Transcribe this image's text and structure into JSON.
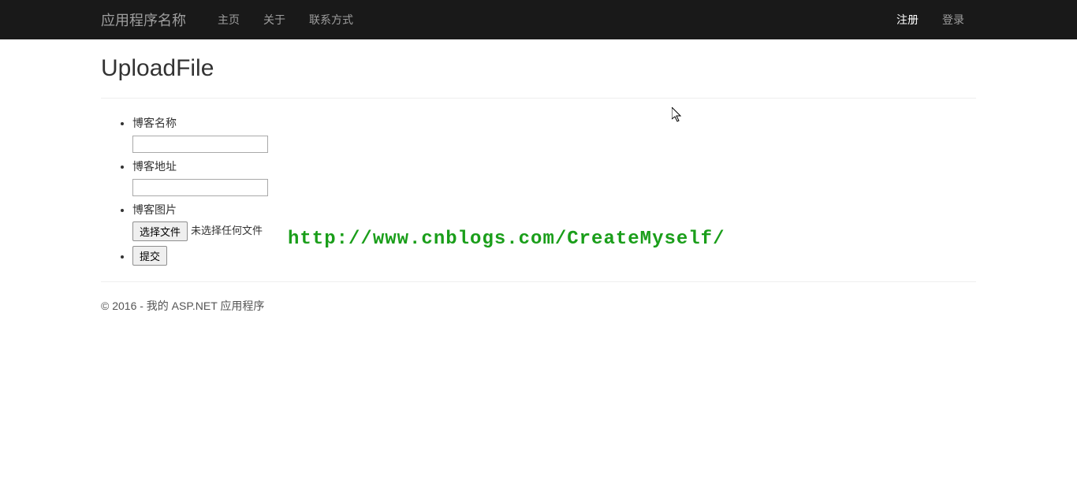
{
  "navbar": {
    "brand": "应用程序名称",
    "links": {
      "home": "主页",
      "about": "关于",
      "contact": "联系方式"
    },
    "right": {
      "register": "注册",
      "login": "登录"
    }
  },
  "page": {
    "title": "UploadFile"
  },
  "form": {
    "blog_name_label": "博客名称",
    "blog_name_value": "",
    "blog_url_label": "博客地址",
    "blog_url_value": "",
    "blog_image_label": "博客图片",
    "file_button_label": "选择文件",
    "file_status": "未选择任何文件",
    "submit_label": "提交"
  },
  "footer": {
    "text": "© 2016 - 我的 ASP.NET 应用程序"
  },
  "watermark": {
    "text": "http://www.cnblogs.com/CreateMyself/"
  }
}
